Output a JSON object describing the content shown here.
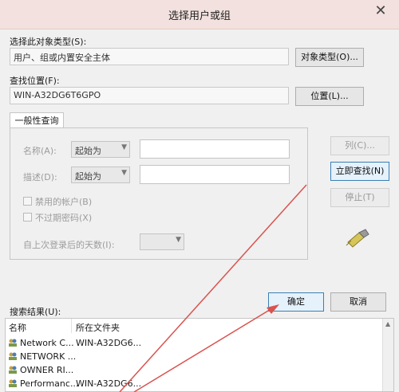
{
  "window": {
    "title": "选择用户或组",
    "close_glyph": "✕"
  },
  "object_type": {
    "label": "选择此对象类型(S):",
    "value": "用户、组或内置安全主体",
    "button": "对象类型(O)..."
  },
  "location": {
    "label": "查找位置(F):",
    "value": "WIN-A32DG6T6GPO",
    "button": "位置(L)..."
  },
  "query": {
    "tab": "一般性查询",
    "name_label": "名称(A):",
    "name_mode": "起始为",
    "desc_label": "描述(D):",
    "desc_mode": "起始为",
    "disabled_accounts": "禁用的帐户(B)",
    "no_expire": "不过期密码(X)",
    "days_label": "自上次登录后的天数(I):"
  },
  "side_buttons": {
    "columns": "列(C)...",
    "find_now": "立即查找(N)",
    "stop": "停止(T)"
  },
  "actions": {
    "ok": "确定",
    "cancel": "取消"
  },
  "results": {
    "label": "搜索结果(U):",
    "headers": {
      "name": "名称",
      "folder": "所在文件夹"
    },
    "rows": [
      {
        "name": "Network C...",
        "folder": "WIN-A32DG6..."
      },
      {
        "name": "NETWORK ...",
        "folder": ""
      },
      {
        "name": "OWNER RI...",
        "folder": ""
      },
      {
        "name": "Performanc...",
        "folder": "WIN-A32DG6..."
      }
    ]
  },
  "colors": {
    "annotation_arrow": "#d9534f"
  }
}
